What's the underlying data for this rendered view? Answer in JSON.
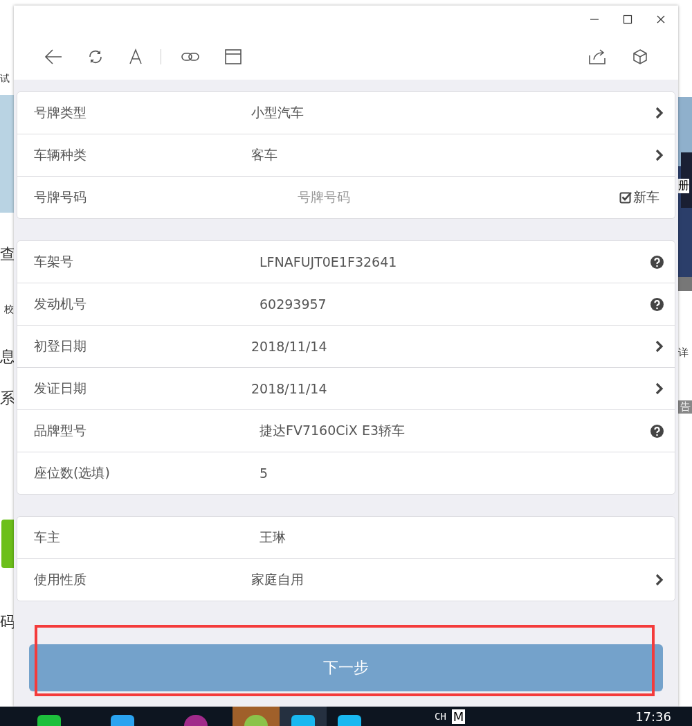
{
  "background": {
    "left_texts": [
      "试",
      "查",
      "校",
      "息",
      "系",
      "码"
    ],
    "right_texts": [
      "册",
      "详",
      "告"
    ]
  },
  "groups": [
    {
      "rows": [
        {
          "kind": "select",
          "label": "号牌类型",
          "value": "小型汽车"
        },
        {
          "kind": "select",
          "label": "车辆种类",
          "value": "客车"
        },
        {
          "kind": "input",
          "label": "号牌号码",
          "placeholder": "号牌号码",
          "check_label": "新车",
          "checked": true
        }
      ]
    },
    {
      "rows": [
        {
          "kind": "help",
          "label": "车架号",
          "value": "LFNAFUJT0E1F32641"
        },
        {
          "kind": "help",
          "label": "发动机号",
          "value": "60293957"
        },
        {
          "kind": "select",
          "label": "初登日期",
          "value": "2018/11/14"
        },
        {
          "kind": "select",
          "label": "发证日期",
          "value": "2018/11/14"
        },
        {
          "kind": "help",
          "label": "品牌型号",
          "value": "捷达FV7160CiX E3轿车"
        },
        {
          "kind": "plain",
          "label": "座位数(选填)",
          "value": "5"
        }
      ]
    },
    {
      "rows": [
        {
          "kind": "plain",
          "label": "车主",
          "value": "王琳"
        },
        {
          "kind": "select",
          "label": "使用性质",
          "value": "家庭自用"
        }
      ]
    }
  ],
  "next_button": "下一步",
  "taskbar": {
    "ime": "CH",
    "ime_mode": "M",
    "time": "17:36"
  }
}
